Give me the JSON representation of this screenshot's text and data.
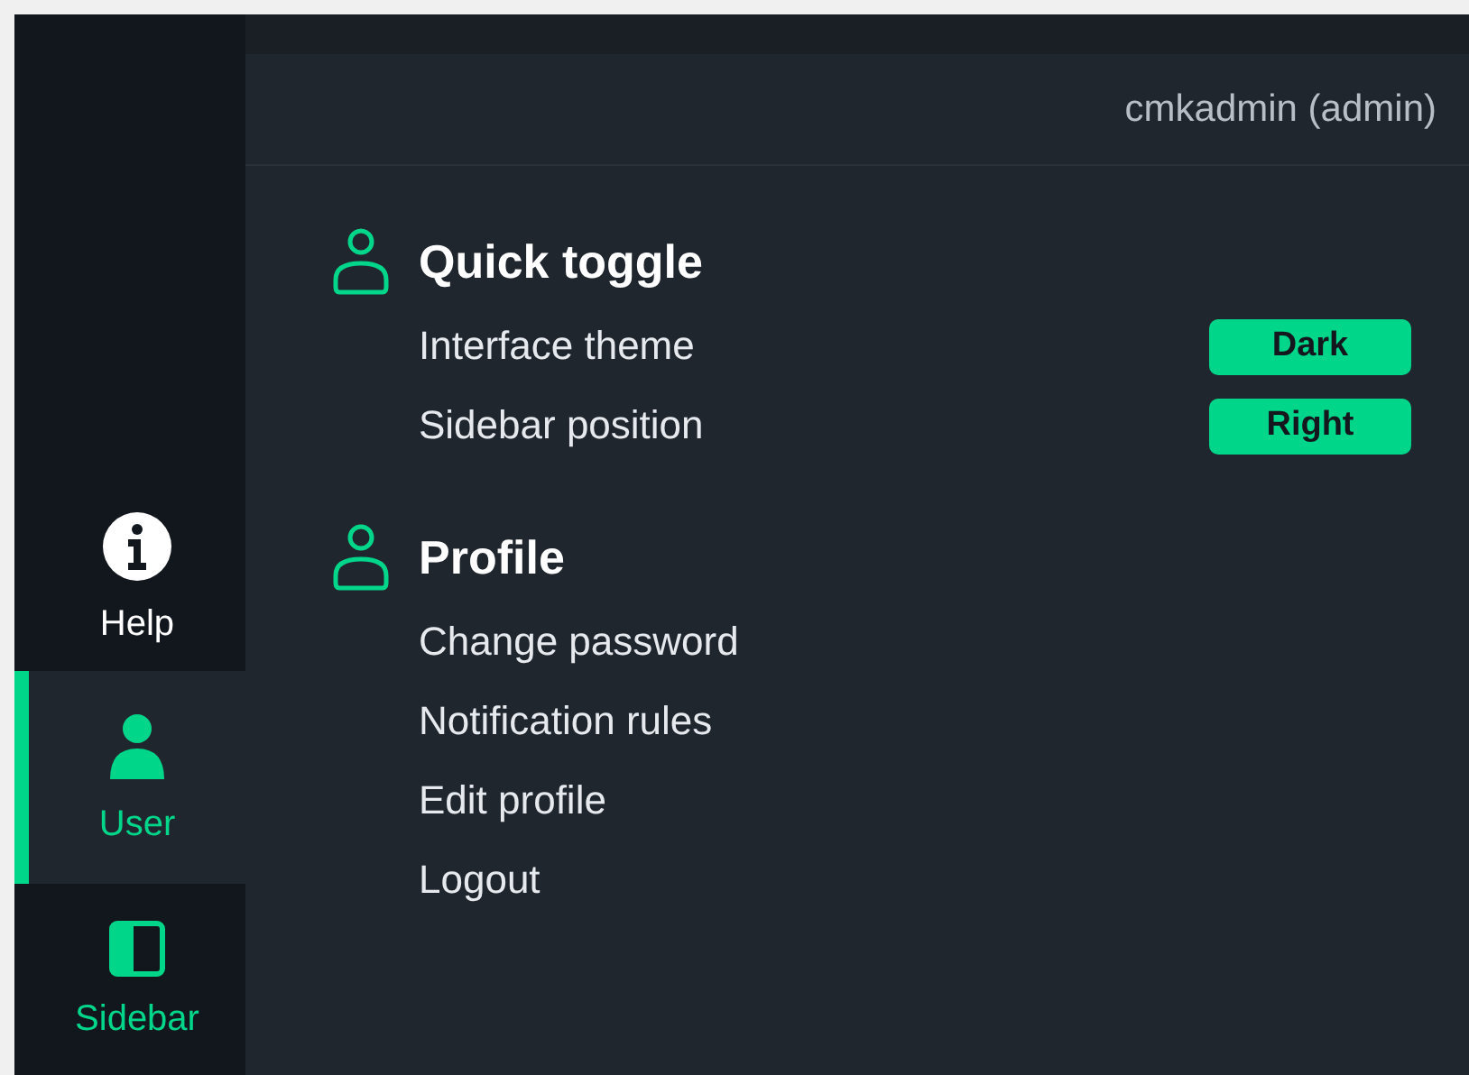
{
  "header": {
    "user": "cmkadmin (admin)"
  },
  "sidebar": {
    "items": [
      {
        "label": "Help",
        "kind": "info",
        "selected": false,
        "active": false
      },
      {
        "label": "User",
        "kind": "user",
        "selected": true,
        "active": true
      },
      {
        "label": "Sidebar",
        "kind": "panel",
        "selected": false,
        "active": true
      }
    ]
  },
  "sections": [
    {
      "title": "Quick toggle",
      "items": [
        {
          "label": "Interface theme",
          "kind": "toggle",
          "value": "Dark"
        },
        {
          "label": "Sidebar position",
          "kind": "toggle",
          "value": "Right"
        }
      ]
    },
    {
      "title": "Profile",
      "items": [
        {
          "label": "Change password",
          "kind": "link"
        },
        {
          "label": "Notification rules",
          "kind": "link"
        },
        {
          "label": "Edit profile",
          "kind": "link"
        },
        {
          "label": "Logout",
          "kind": "link"
        }
      ]
    }
  ]
}
